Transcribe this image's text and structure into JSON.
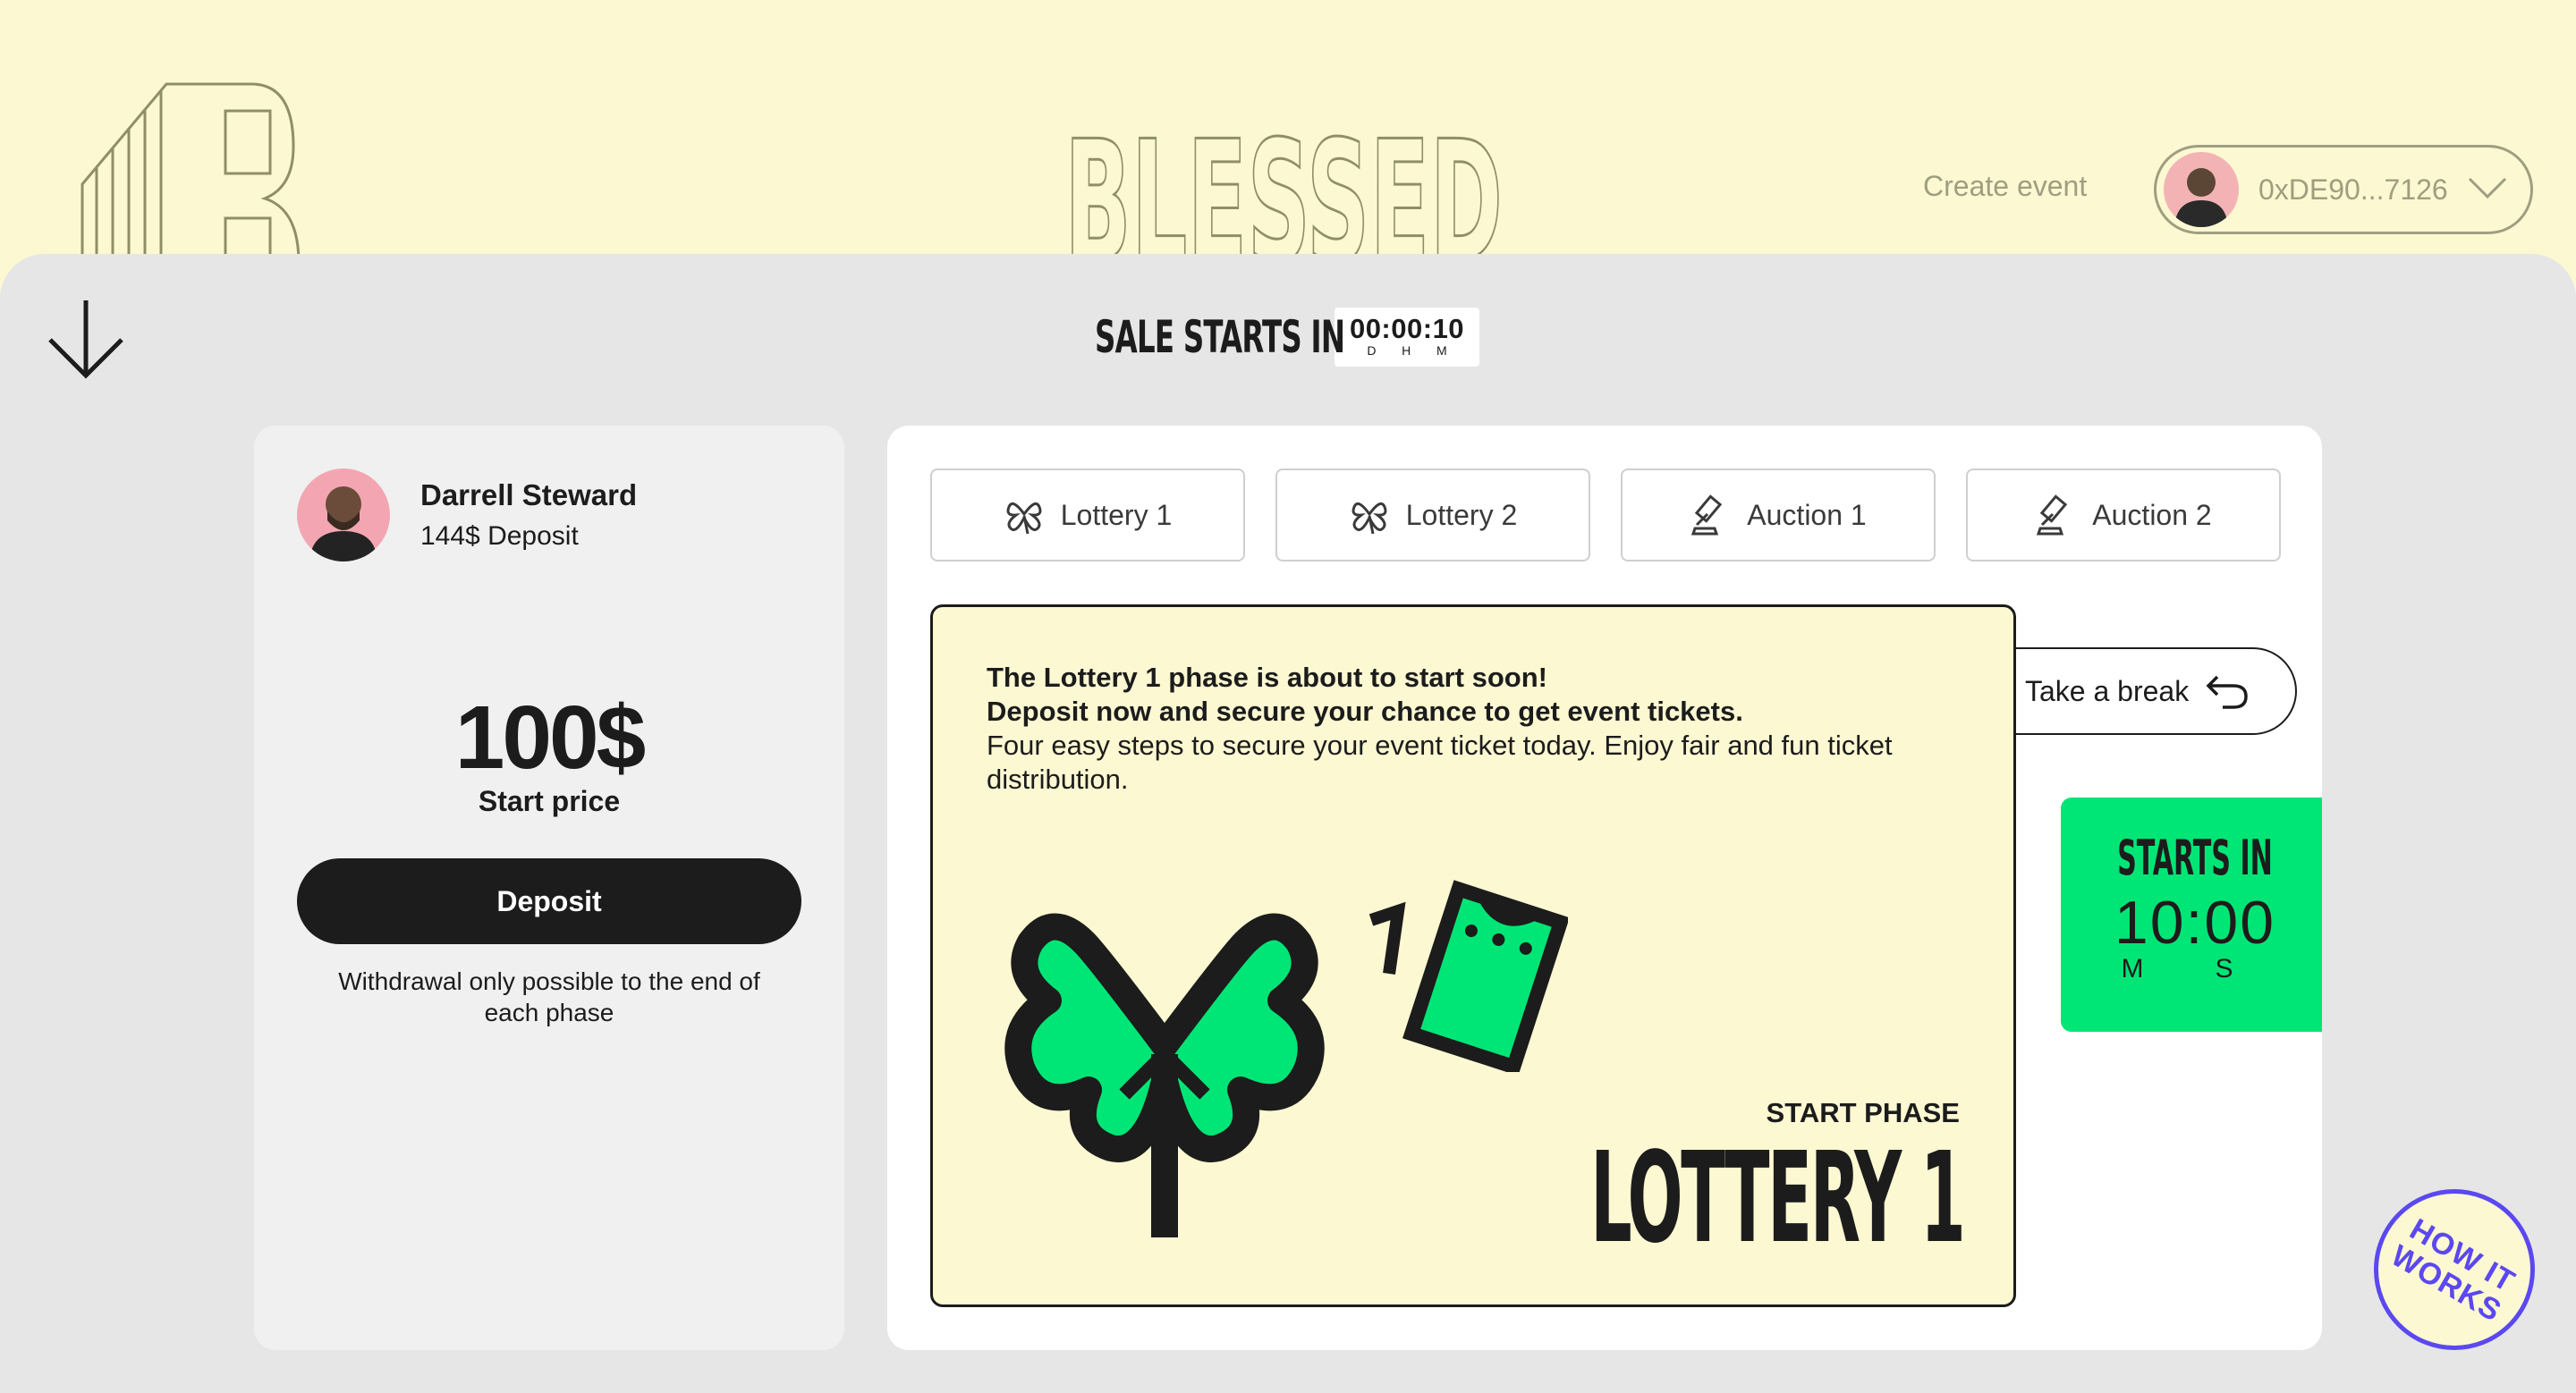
{
  "header": {
    "brand": "BLESSED",
    "create_event": "Create event",
    "wallet_address": "0xDE90...7126"
  },
  "sale": {
    "title": "SALE STARTS IN",
    "timer": "00:00:10",
    "units": [
      "D",
      "H",
      "M"
    ]
  },
  "user": {
    "name": "Darrell Steward",
    "deposit": "144$ Deposit"
  },
  "pricing": {
    "price": "100$",
    "label": "Start price",
    "deposit_button": "Deposit",
    "note": "Withdrawal only possible to the end of each phase"
  },
  "tabs": [
    {
      "label": "Lottery 1",
      "icon": "clover-icon"
    },
    {
      "label": "Lottery 2",
      "icon": "clover-icon"
    },
    {
      "label": "Auction 1",
      "icon": "gavel-icon"
    },
    {
      "label": "Auction 2",
      "icon": "gavel-icon"
    }
  ],
  "phase": {
    "headline_1": "The Lottery 1 phase is about to start soon!",
    "headline_2": "Deposit now and secure your chance to get event tickets.",
    "body": "Four easy steps to secure your event ticket today. Enjoy fair and fun ticket distribution.",
    "sub": "START PHASE",
    "name": "LOTTERY 1"
  },
  "break_button": "Take a break",
  "countdown": {
    "title": "STARTS IN",
    "value": "10:00",
    "units": [
      "M",
      "S"
    ]
  },
  "how_it_works": "HOW IT WORKS",
  "colors": {
    "background": "#fcf8d2",
    "sheet": "#e6e6e6",
    "accent_green": "#00e676",
    "badge_purple": "#5b48f0",
    "dark": "#1c1c1c"
  }
}
